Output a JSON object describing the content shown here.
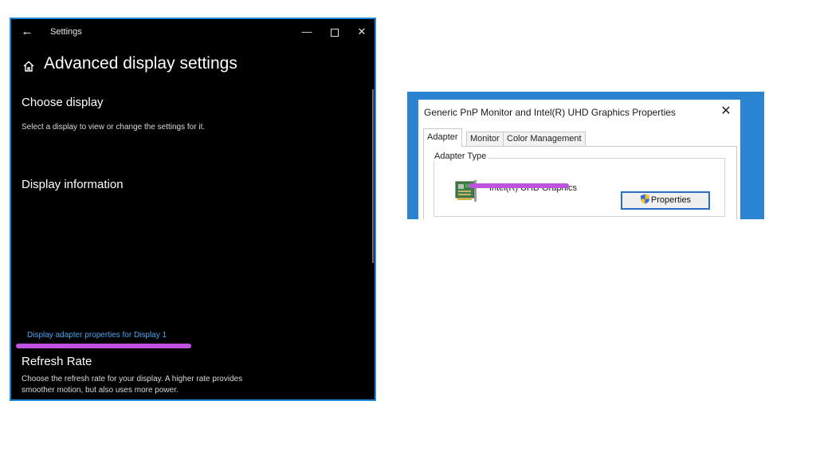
{
  "settings": {
    "window_title": "Settings",
    "page_title": "Advanced display settings",
    "choose_display": {
      "title": "Choose display",
      "description": "Select a display to view or change the settings for it."
    },
    "display_information": {
      "title": "Display information"
    },
    "adapter_link": "Display adapter properties for Display 1",
    "refresh_rate": {
      "title": "Refresh Rate",
      "description": "Choose the refresh rate for your display. A higher rate provides smoother motion, but also uses more power."
    },
    "icons": {
      "back": "back-arrow-icon",
      "home": "home-icon",
      "minimize": "minimize-icon",
      "maximize": "maximize-icon",
      "close": "close-icon"
    },
    "colors": {
      "background": "#000000",
      "link": "#4aa3f0",
      "accent_border": "#1e88d6"
    }
  },
  "properties_dialog": {
    "title": "Generic PnP Monitor and Intel(R) UHD Graphics Properties",
    "tabs": [
      {
        "label": "Adapter",
        "active": true
      },
      {
        "label": "Monitor",
        "active": false
      },
      {
        "label": "Color Management",
        "active": false
      }
    ],
    "adapter_type_label": "Adapter Type",
    "adapter_name": "Intel(R) UHD Graphics",
    "properties_button": "Properties",
    "icons": {
      "close": "close-icon",
      "adapter": "graphics-card-icon",
      "shield": "uac-shield-icon"
    }
  },
  "highlight_color": "#bf53e0"
}
